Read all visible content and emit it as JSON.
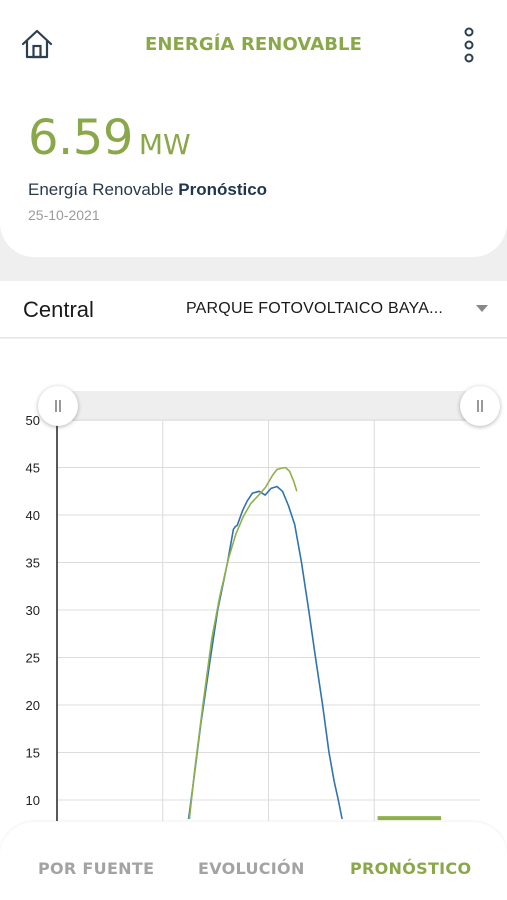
{
  "header": {
    "title": "ENERGÍA RENOVABLE",
    "home_icon": "home-icon",
    "menu_icon": "more-vertical-icon"
  },
  "summary": {
    "value": "6.59",
    "unit": "MW",
    "label_prefix": "Energía Renovable",
    "label_emphasis": "Pronóstico",
    "date": "25-10-2021"
  },
  "selector": {
    "label": "Central",
    "value": "PARQUE FOTOVOLTAICO BAYA..."
  },
  "colors": {
    "accent": "#8aa84a",
    "real_line": "#2f73b0",
    "forecast_line": "#8fb04a"
  },
  "chart_data": {
    "type": "line",
    "y_ticks": [
      "50",
      "45",
      "40",
      "35",
      "30",
      "25",
      "20",
      "15",
      "10"
    ],
    "ylim": [
      8,
      50
    ],
    "xlim": [
      0,
      100
    ],
    "grid": true,
    "series": [
      {
        "x": [
          31.1,
          32.3,
          34.0,
          36.3,
          38.0,
          40.3,
          41.7,
          42.2,
          42.6,
          43.9,
          45.0,
          46.2,
          47.8,
          49.2,
          50.6,
          52.0,
          53.3,
          54.7,
          56.2,
          57.8,
          59.5,
          61.1,
          62.8,
          64.3,
          65.5,
          66.5,
          67.4
        ],
        "values": [
          8.0,
          12.0,
          18.0,
          25.0,
          30.0,
          35.0,
          38.5,
          38.8,
          38.9,
          40.5,
          41.5,
          42.3,
          42.5,
          42.1,
          42.8,
          43.0,
          42.5,
          41.0,
          39.0,
          35.0,
          30.0,
          25.0,
          20.0,
          15.0,
          12.0,
          10.0,
          8.0
        ]
      },
      {
        "x": [
          31.3,
          32.5,
          34.5,
          36.6,
          38.5,
          40.6,
          42.3,
          44.0,
          45.8,
          47.5,
          49.3,
          51.0,
          52.0,
          53.0,
          54.0,
          55.0,
          56.0,
          56.7
        ],
        "values": [
          8.0,
          13.0,
          20.0,
          27.0,
          31.5,
          35.5,
          38.0,
          39.8,
          41.2,
          42.0,
          42.9,
          44.2,
          44.8,
          44.9,
          45.0,
          44.6,
          43.5,
          42.5
        ]
      },
      {
        "x": [
          75.8,
          90.8
        ],
        "values": [
          8.1,
          8.1
        ]
      }
    ]
  },
  "tabs": [
    {
      "label": "POR FUENTE",
      "active": false
    },
    {
      "label": "EVOLUCIÓN",
      "active": false
    },
    {
      "label": "PRONÓSTICO",
      "active": true
    }
  ]
}
